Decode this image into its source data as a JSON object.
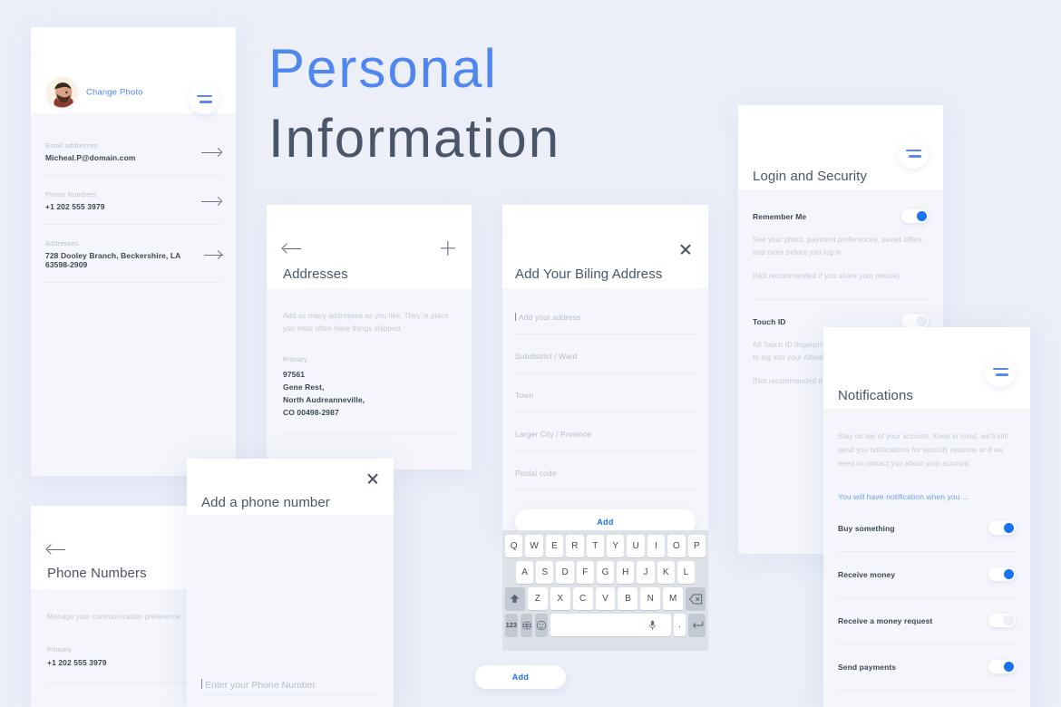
{
  "page": {
    "background": "#eceff8",
    "accent": "#1a73f0",
    "title_line1": "Personal",
    "title_line2": "Information",
    "title_color_line1": "#4f86f0",
    "title_color_line2": "#4a5568"
  },
  "profile_card": {
    "change_photo_label": "Change Photo",
    "menu_icon": "hamburger-icon",
    "avatar_icon": "avatar-photo",
    "rows": [
      {
        "label": "Email addresses",
        "value": "Micheal.P@domain.com",
        "chevron": "arrow-right-icon"
      },
      {
        "label": "Phone Numbers",
        "value": "+1 202 555 3979",
        "chevron": "arrow-right-icon"
      },
      {
        "label": "Addresses",
        "value": "728 Dooley Branch, Beckershire, LA 63598-2909",
        "chevron": "arrow-right-icon"
      }
    ]
  },
  "addresses_card": {
    "back_icon": "arrow-left-icon",
    "add_icon": "plus-icon",
    "title": "Addresses",
    "description": "Add as many addresses as you like. They're place you most often have things shipped.",
    "primary_label": "Primary",
    "address_lines": [
      "97561",
      "Gene Rest,",
      "North Audreanneville,",
      "CO 00498-2987"
    ]
  },
  "billing_card": {
    "close_icon": "close-icon",
    "title": "Add Your Biling Address",
    "fields": [
      {
        "placeholder": "Add your address",
        "focused": true
      },
      {
        "placeholder": "Subdistrict / Ward",
        "focused": false
      },
      {
        "placeholder": "Town",
        "focused": false
      },
      {
        "placeholder": "Larger City / Province",
        "focused": false
      },
      {
        "placeholder": "Postal code",
        "focused": false
      }
    ],
    "add_button_label": "Add"
  },
  "keyboard": {
    "row1": [
      "Q",
      "W",
      "E",
      "R",
      "T",
      "Y",
      "U",
      "I",
      "O",
      "P"
    ],
    "row2": [
      "A",
      "S",
      "D",
      "F",
      "G",
      "H",
      "J",
      "K",
      "L"
    ],
    "row3": [
      "Z",
      "X",
      "C",
      "V",
      "B",
      "N",
      "M"
    ],
    "shift_icon": "shift-up-icon",
    "backspace_icon": "backspace-icon",
    "numbers_key": "123",
    "globe_icon": "globe-icon",
    "emoji_icon": "emoji-icon",
    "mic_icon": "microphone-icon",
    "period_key": ".",
    "enter_icon": "enter-return-icon"
  },
  "phone_numbers_card": {
    "back_icon": "arrow-left-icon",
    "title": "Phone Numbers",
    "description": "Manage your communication preference",
    "primary_label": "Primary",
    "phone_value": "+1 202 555 3979"
  },
  "add_phone_modal": {
    "close_icon": "close-icon",
    "title": "Add a phone number",
    "field_placeholder": "Enter your Phone Number",
    "add_button_label": "Add"
  },
  "login_security_card": {
    "menu_icon": "hamburger-icon",
    "title": "Login and Security",
    "items": [
      {
        "label": "Remember Me",
        "desc1": "See your photo, payment preferences, saved offers, and more before you log in.",
        "desc2": "(Not recommended if you share your device)",
        "toggle_on": true
      },
      {
        "label": "Touch ID",
        "desc1": "All Touch ID fingerprints on this device can be used to log into your Altwallet account.",
        "desc2": "(Not recommended if you share your device)",
        "toggle_on": false
      }
    ]
  },
  "notifications_card": {
    "menu_icon": "hamburger-icon",
    "title": "Notifications",
    "description": "Stay on top of your account. Keep in mind, we'll still send you notifications for security reasons or if we need to contact you about your account.",
    "link_text": "You will have notification when you ...",
    "toggles": [
      {
        "label": "Buy something",
        "on": true
      },
      {
        "label": "Receive money",
        "on": true
      },
      {
        "label": "Receive a money request",
        "on": false
      },
      {
        "label": "Send payments",
        "on": true
      }
    ]
  }
}
